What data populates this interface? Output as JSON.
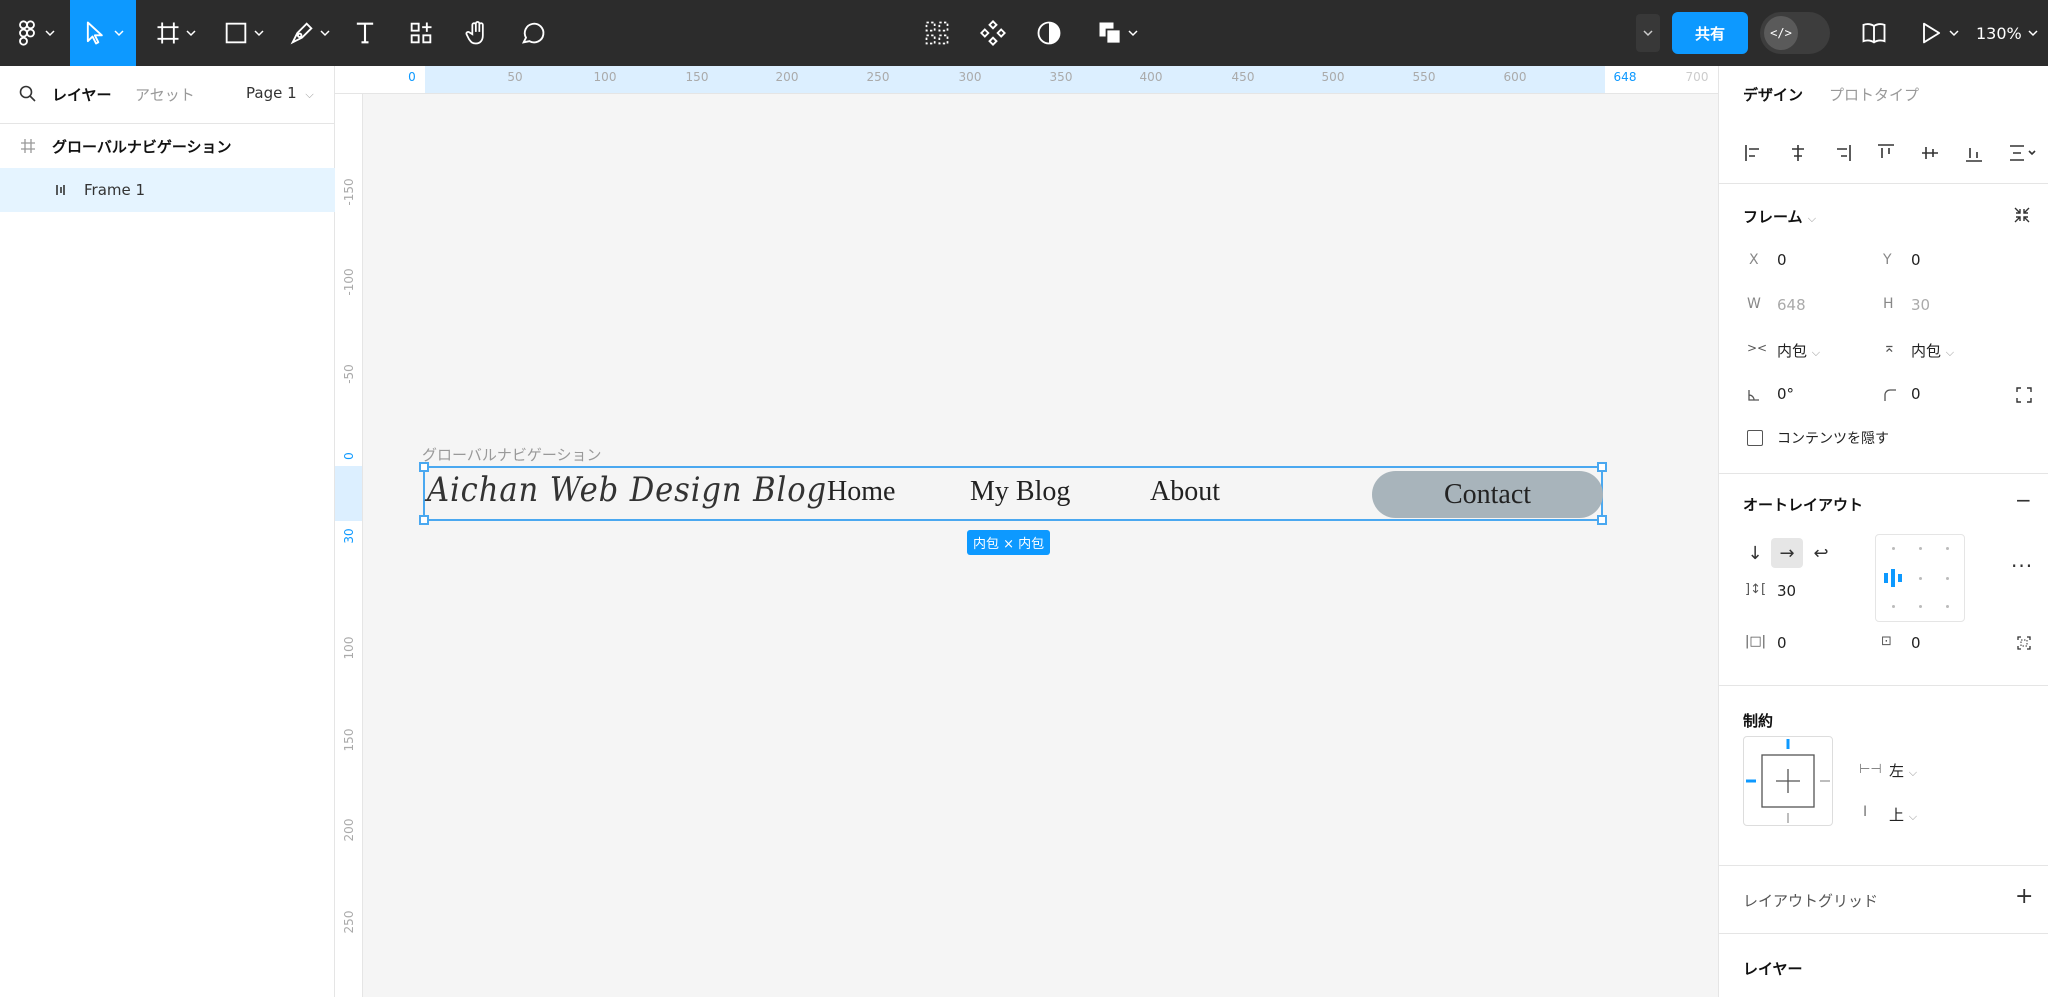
{
  "toolbar": {
    "share_label": "共有",
    "dev_mode_label": "</>",
    "zoom": "130%"
  },
  "left_panel": {
    "tab_layers": "レイヤー",
    "tab_assets": "アセット",
    "page": "Page 1",
    "layers": [
      {
        "name": "グローバルナビゲーション"
      },
      {
        "name": "Frame 1"
      }
    ]
  },
  "ruler_top": {
    "ticks": [
      "0",
      "50",
      "100",
      "150",
      "200",
      "250",
      "300",
      "350",
      "400",
      "450",
      "500",
      "550",
      "600",
      "648",
      "700"
    ]
  },
  "ruler_left": {
    "ticks": [
      "-150",
      "-100",
      "-50",
      "0",
      "30",
      "100",
      "150",
      "200",
      "250"
    ]
  },
  "canvas": {
    "frame_label": "グローバルナビゲーション",
    "logo": "Aichan Web Design Blog",
    "nav": [
      "Home",
      "My Blog",
      "About"
    ],
    "contact": "Contact",
    "size_badge": "内包 × 内包"
  },
  "right_panel": {
    "tab_design": "デザイン",
    "tab_prototype": "プロトタイプ",
    "frame_section": {
      "title": "フレーム",
      "x_label": "X",
      "x": "0",
      "y_label": "Y",
      "y": "0",
      "w_label": "W",
      "w": "648",
      "h_label": "H",
      "h": "30",
      "h_sizing": "内包",
      "v_sizing": "内包",
      "rotation": "0°",
      "radius": "0",
      "clip_label": "コンテンツを隠す"
    },
    "auto_layout": {
      "title": "オートレイアウト",
      "gap": "30",
      "padding_h": "0",
      "padding_v": "0"
    },
    "constraints": {
      "title": "制約",
      "horizontal": "左",
      "vertical": "上"
    },
    "layout_grid_title": "レイアウトグリッド",
    "layer_title": "レイヤー"
  }
}
